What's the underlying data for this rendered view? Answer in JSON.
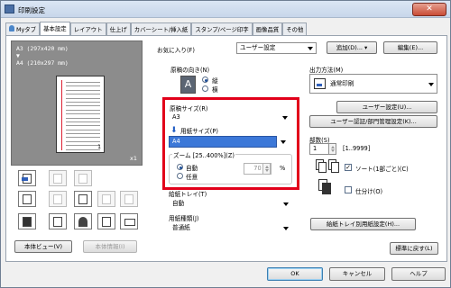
{
  "window": {
    "title": "印刷設定",
    "close_symbol": "✕"
  },
  "tabs": [
    {
      "label": "Myタブ"
    },
    {
      "label": "基本設定"
    },
    {
      "label": "レイアウト"
    },
    {
      "label": "仕上げ"
    },
    {
      "label": "カバーシート/挿入紙"
    },
    {
      "label": "スタンプ/ページ印字"
    },
    {
      "label": "画像品質"
    },
    {
      "label": "その他"
    }
  ],
  "favorites": {
    "label": "お気に入り(F)",
    "value": "ユーザー設定",
    "add_button": "追加(D)...",
    "edit_button": "編集(E)..."
  },
  "preview": {
    "line1": "A3 (297x420 mm)",
    "arrow": "▼",
    "line2": "A4 (210x297 mm)",
    "page_number": "1",
    "copies": "x1"
  },
  "left_buttons": {
    "body_view": "本体ビュー(V)",
    "body_info": "本体情報(I)"
  },
  "orientation": {
    "label": "原稿の向き(N)",
    "portrait": "縦",
    "landscape": "横"
  },
  "original_size": {
    "label": "原稿サイズ(R)",
    "value": "A3"
  },
  "paper_size": {
    "label": "用紙サイズ(P)",
    "value": "A4"
  },
  "zoom": {
    "label": "ズーム [25..400%](Z)",
    "auto": "自動",
    "manual": "任意",
    "value": "70",
    "unit": "%"
  },
  "paper_tray": {
    "label": "給紙トレイ(T)",
    "value": "自動"
  },
  "paper_type": {
    "label": "用紙種類(J)",
    "value": "普通紙"
  },
  "output": {
    "label": "出力方法(M)",
    "value": "通常印刷",
    "user_settings": "ユーザー設定(U)...",
    "auth_settings": "ユーザー認証/部門管理設定(K)..."
  },
  "copies": {
    "label": "部数(S)",
    "value": "1",
    "range": "[1..9999]"
  },
  "collate": {
    "sort_label": "ソート(1部ごと)(C)",
    "offset_label": "仕分け(O)"
  },
  "tray_settings_button": "給紙トレイ別用紙設定(H)...",
  "restore_defaults": "標準に戻す(L)",
  "footer": {
    "ok": "OK",
    "cancel": "キャンセル",
    "help": "ヘルプ"
  }
}
